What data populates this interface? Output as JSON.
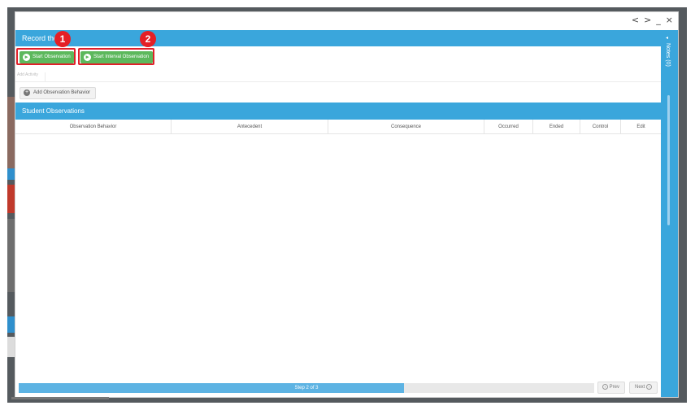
{
  "window": {
    "controls": {
      "prev": "<",
      "next": ">",
      "minimize": "_",
      "close": "×"
    }
  },
  "header": {
    "title": "Record the"
  },
  "actions": {
    "start_observation": "Start Observation",
    "start_interval_observation": "Start Interval Observation"
  },
  "callouts": [
    "1",
    "2"
  ],
  "tabs": {
    "first": "Add Activity"
  },
  "add_behavior": {
    "label": "Add Observation Behavior"
  },
  "section": {
    "title": "Student Observations"
  },
  "table": {
    "columns": [
      "Observation Behavior",
      "Antecedent",
      "Consequence",
      "Occurred",
      "Ended",
      "Control",
      "Edit"
    ],
    "rows": []
  },
  "side_panel": {
    "label": "Notes (0)"
  },
  "footer": {
    "progress_text": "Step 2 of 3",
    "progress_fraction": 0.67,
    "prev_label": "Prev",
    "next_label": "Next"
  },
  "colors": {
    "accent": "#3aa6dc",
    "green": "#5cb85c",
    "callout": "#e41f26"
  }
}
